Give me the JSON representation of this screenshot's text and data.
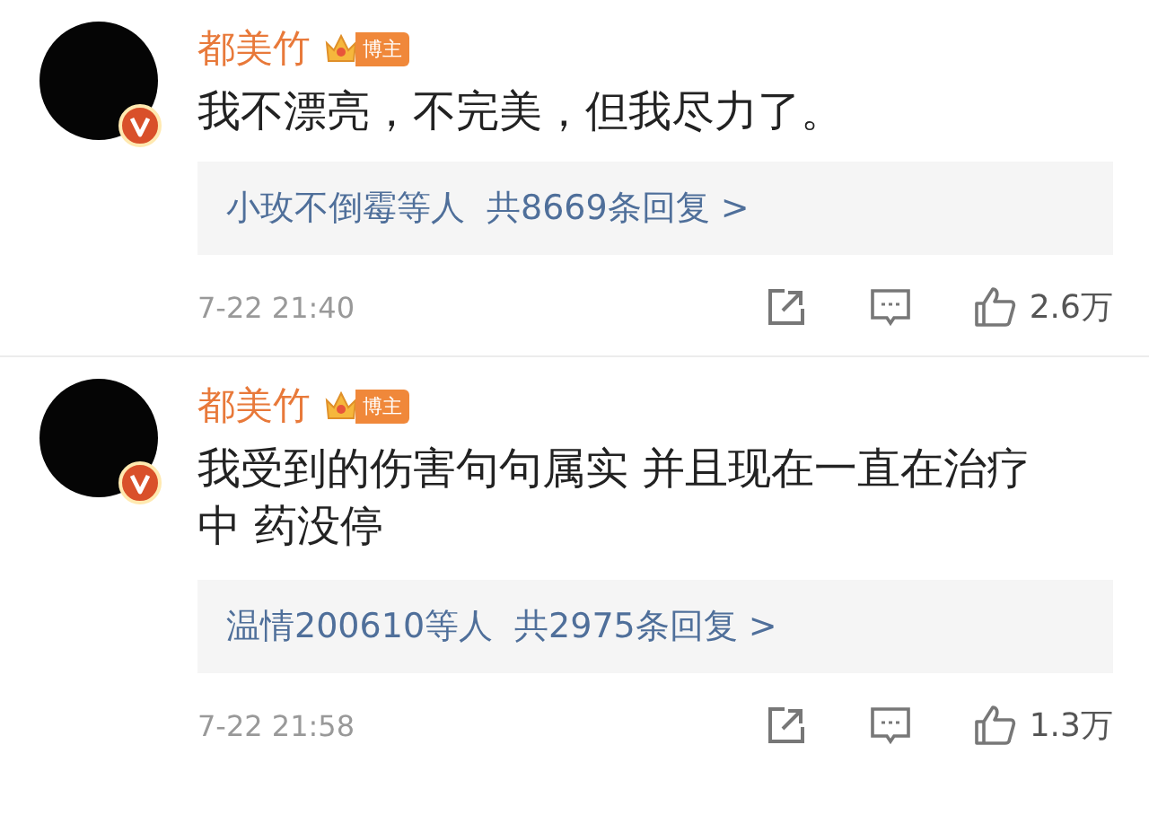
{
  "comments": [
    {
      "author": "都美竹",
      "author_badge": "博主",
      "verified": true,
      "text": "我不漂亮，不完美，但我尽力了。",
      "reply_names": "小玫不倒霉等人",
      "reply_count": "共8669条回复 >",
      "time": "7-22 21:40",
      "likes": "2.6万"
    },
    {
      "author": "都美竹",
      "author_badge": "博主",
      "verified": true,
      "text": "我受到的伤害句句属实 并且现在一直在治疗中 药没停",
      "reply_names": "温情200610等人",
      "reply_count": "共2975条回复 >",
      "time": "7-22 21:58",
      "likes": "1.3万"
    }
  ]
}
